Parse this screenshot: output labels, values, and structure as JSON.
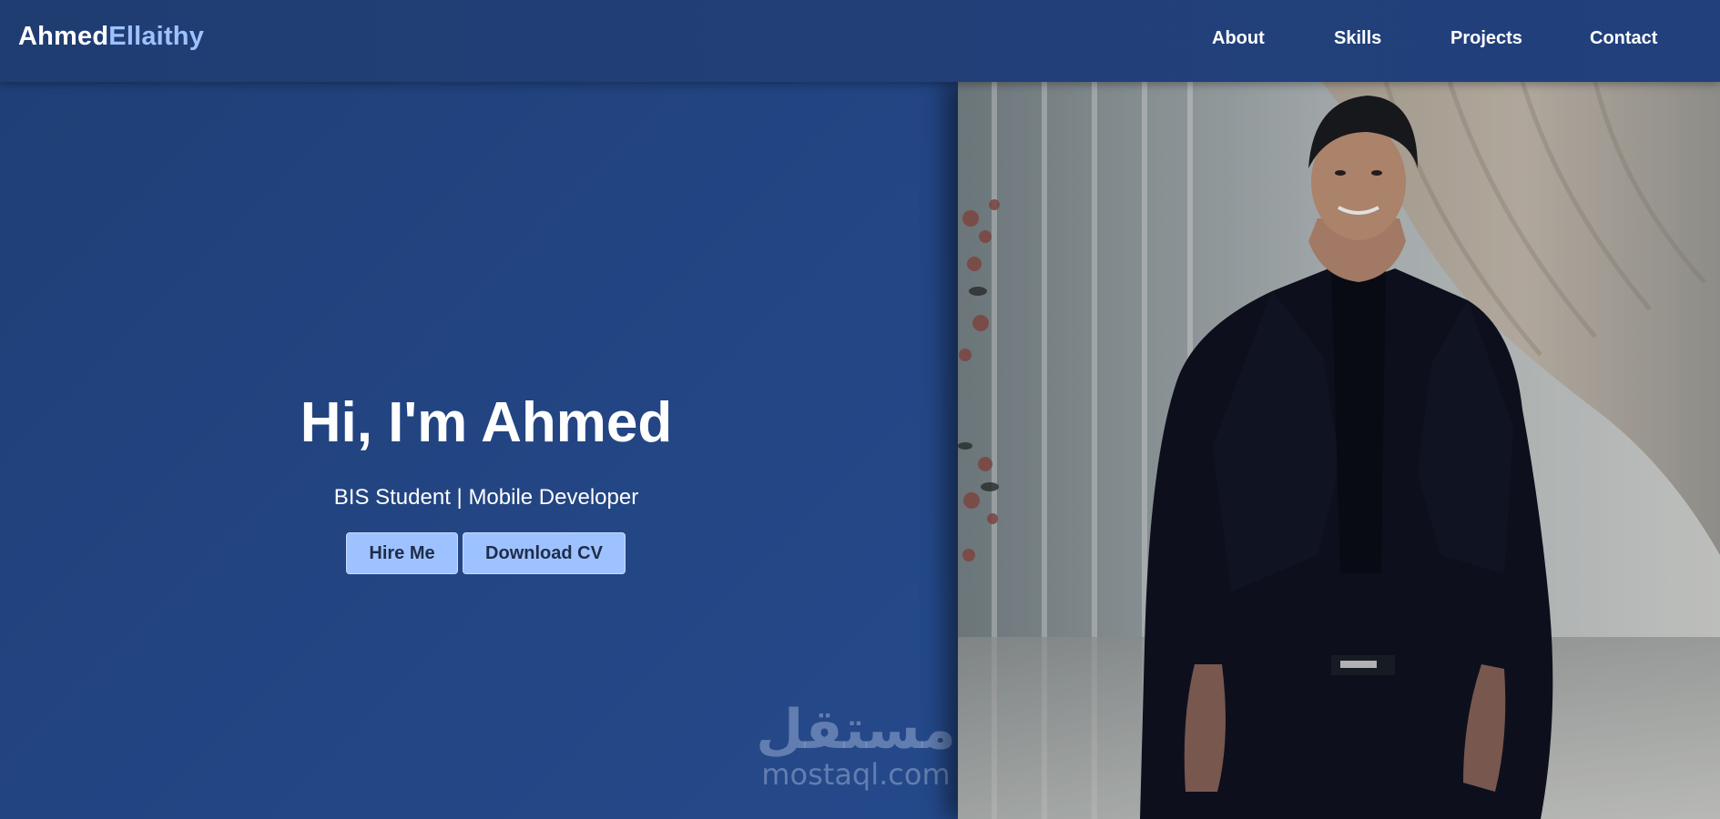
{
  "navbar": {
    "logo_first": "Ahmed",
    "logo_last": "Ellaithy",
    "links": [
      "About",
      "Skills",
      "Projects",
      "Contact"
    ]
  },
  "hero": {
    "title": "Hi, I'm Ahmed",
    "subtitle": "BIS Student | Mobile Developer",
    "hire_label": "Hire Me",
    "cv_label": "Download CV"
  },
  "watermark": {
    "arabic": "مستقل",
    "latin": "mostaql.com"
  },
  "colors": {
    "accent": "#9ec2ff",
    "background": "#234684",
    "navbar": "#203d72"
  }
}
